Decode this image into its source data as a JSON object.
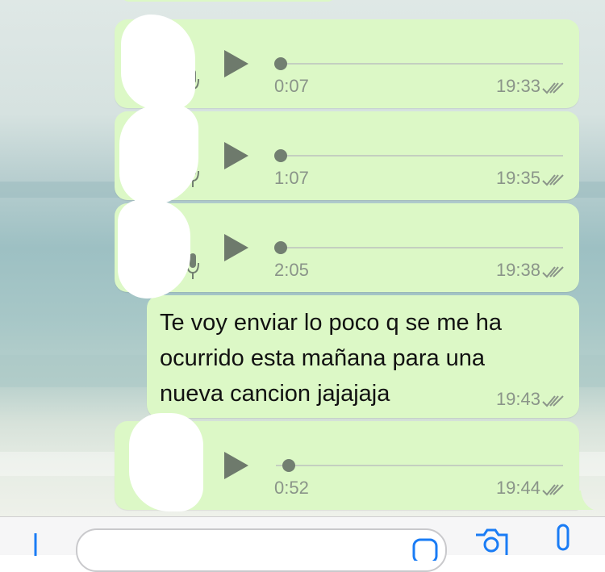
{
  "messages": [
    {
      "type": "voice",
      "duration": "0:07",
      "time": "19:33",
      "status": "read"
    },
    {
      "type": "voice",
      "duration": "1:07",
      "time": "19:35",
      "status": "read"
    },
    {
      "type": "voice",
      "duration": "2:05",
      "time": "19:38",
      "status": "read"
    },
    {
      "type": "text",
      "lines": [
        "Te voy enviar lo poco q se me ha",
        "ocurrido esta mañana para una",
        "nueva cancion jajajaja"
      ],
      "time": "19:43",
      "status": "read"
    },
    {
      "type": "voice",
      "duration": "0:52",
      "time": "19:44",
      "status": "read"
    }
  ],
  "icons": {
    "play": "play-icon",
    "mic": "microphone-icon",
    "read": "double-check-icon",
    "attach": "plus-icon",
    "camera": "camera-icon",
    "record": "microphone-icon"
  },
  "colors": {
    "bubble": "#dcf8c6",
    "meta_text": "#8a9489",
    "play": "#6e7a6c",
    "redaction": "#ffffff"
  }
}
